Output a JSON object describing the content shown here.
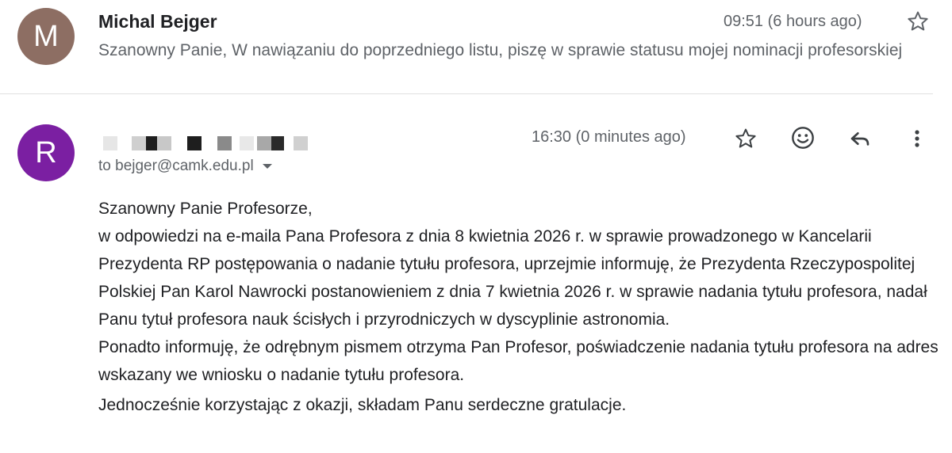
{
  "colors": {
    "avatar_m": "#8d6e63",
    "avatar_r": "#7b1fa2",
    "text_primary": "#202124",
    "text_secondary": "#5f6368"
  },
  "thread": [
    {
      "avatar_letter": "M",
      "sender": "Michal Bejger",
      "time": "09:51 (6 hours ago)",
      "snippet": "Szanowny Panie, W nawiązaniu do poprzedniego listu, piszę w sprawie statusu mojej nominacji profesorskiej",
      "icons": [
        "star-icon"
      ]
    },
    {
      "avatar_letter": "R",
      "sender_redacted": true,
      "time": "16:30 (0 minutes ago)",
      "recipient": "to bejger@camk.edu.pl",
      "icons": [
        "star-icon",
        "emoji-icon",
        "reply-icon",
        "more-vert-icon"
      ],
      "body": {
        "greeting": "Szanowny Panie Profesorze,",
        "paragraph1": "w odpowiedzi na e-maila Pana Profesora z dnia 8 kwietnia 2026 r. w sprawie prowadzonego w Kancelarii Prezydenta RP postępowania o nadanie tytułu profesora, uprzejmie informuję, że Prezydenta Rzeczypospolitej Polskiej Pan Karol Nawrocki postanowieniem z dnia 7 kwietnia 2026 r. w sprawie nadania tytułu profesora, nadał Panu tytuł profesora nauk ścisłych i przyrodniczych w dyscyplinie astronomia.",
        "paragraph2": "Ponadto informuję, że odrębnym pismem otrzyma Pan Profesor, poświadczenie nadania tytułu profesora na adres wskazany we wniosku o nadanie tytułu profesora.",
        "closing": "Jednocześnie korzystając z okazji, składam Panu serdeczne gratulacje."
      }
    }
  ]
}
